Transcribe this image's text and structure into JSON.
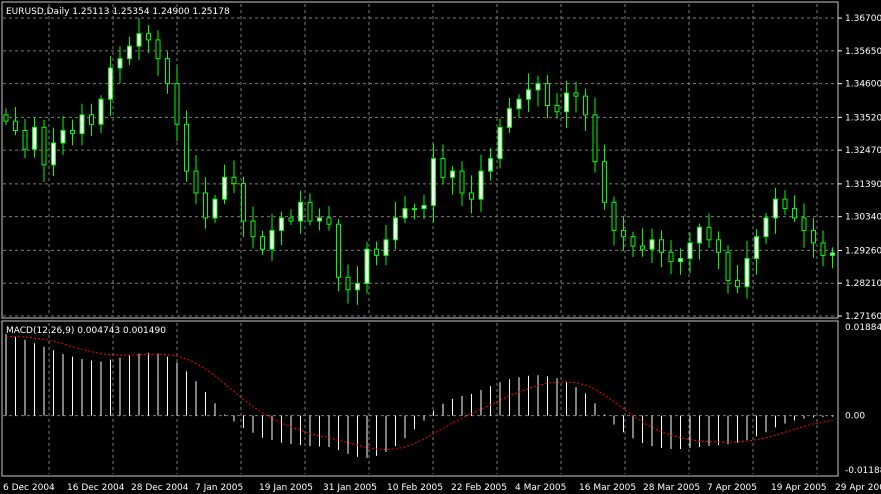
{
  "main_pane": {
    "title": "EURUSD,Daily  1.25113 1.25354 1.24900 1.25178",
    "price_ticks": [
      "1.36700",
      "1.35650",
      "1.34600",
      "1.33520",
      "1.32470",
      "1.31390",
      "1.30340",
      "1.29260",
      "1.28210",
      "1.27160"
    ]
  },
  "macd_pane": {
    "title": "MACD(12,26,9) 0.004743 0.001490",
    "ticks": [
      "0.018842",
      "0.00",
      "-0.011885"
    ]
  },
  "date_ticks": [
    "6 Dec 2004",
    "16 Dec 2004",
    "28 Dec 2004",
    "7 Jan 2005",
    "19 Jan 2005",
    "31 Jan 2005",
    "10 Feb 2005",
    "22 Feb 2005",
    "4 Mar 2005",
    "16 Mar 2005",
    "28 Mar 2005",
    "7 Apr 2005",
    "19 Apr 2005",
    "29 Apr 200"
  ],
  "colors": {
    "background": "#000000",
    "grid": "#7c7c7c",
    "candle_bull": "#ffffff",
    "candle_bear": "#000000",
    "wick": "#00ff00",
    "macd_histogram": "#ffffff",
    "signal_line": "#ff0000"
  },
  "chart_data": [
    {
      "type": "candlestick",
      "symbol": "EURUSD",
      "timeframe": "Daily",
      "ylim": [
        1.2716,
        1.3715
      ],
      "close": [
        1.334,
        1.331,
        1.325,
        1.332,
        1.32,
        1.327,
        1.331,
        1.33,
        1.336,
        1.333,
        1.341,
        1.351,
        1.354,
        1.358,
        1.362,
        1.36,
        1.354,
        1.346,
        1.333,
        1.318,
        1.311,
        1.303,
        1.309,
        1.316,
        1.314,
        1.302,
        1.297,
        1.293,
        1.299,
        1.303,
        1.302,
        1.308,
        1.302,
        1.303,
        1.301,
        1.284,
        1.28,
        1.282,
        1.293,
        1.291,
        1.296,
        1.303,
        1.306,
        1.306,
        1.307,
        1.322,
        1.316,
        1.318,
        1.311,
        1.309,
        1.318,
        1.322,
        1.332,
        1.338,
        1.341,
        1.344,
        1.346,
        1.339,
        1.337,
        1.343,
        1.342,
        1.336,
        1.321,
        1.308,
        1.299,
        1.297,
        1.294,
        1.293,
        1.296,
        1.292,
        1.289,
        1.29,
        1.295,
        1.3,
        1.296,
        1.292,
        1.283,
        1.281,
        1.29,
        1.297,
        1.303,
        1.309,
        1.306,
        1.303,
        1.299,
        1.295,
        1.291,
        1.2918
      ]
    },
    {
      "type": "bar",
      "indicator": "MACD(12,26,9)",
      "ylim": [
        -0.011885,
        0.018842
      ],
      "series": [
        {
          "values": [
            0.0166,
            0.016,
            0.0154,
            0.0147,
            0.014,
            0.0133,
            0.0125,
            0.012,
            0.0115,
            0.0112,
            0.011,
            0.0114,
            0.0118,
            0.0122,
            0.0126,
            0.0128,
            0.0126,
            0.012,
            0.0108,
            0.009,
            0.007,
            0.0048,
            0.0025,
            0.0002,
            -0.0012,
            -0.0025,
            -0.0035,
            -0.0045,
            -0.005,
            -0.0055,
            -0.0058,
            -0.006,
            -0.0062,
            -0.0063,
            -0.0064,
            -0.007,
            -0.0078,
            -0.0084,
            -0.0086,
            -0.0082,
            -0.0074,
            -0.0062,
            -0.0046,
            -0.0028,
            -0.001,
            0.001,
            0.0024,
            0.0034,
            0.004,
            0.0044,
            0.0052,
            0.006,
            0.0068,
            0.0074,
            0.0078,
            0.0081,
            0.0082,
            0.008,
            0.0076,
            0.0068,
            0.0058,
            0.0045,
            0.0025,
            0.0002,
            -0.0018,
            -0.0034,
            -0.0046,
            -0.0056,
            -0.0062,
            -0.0066,
            -0.0068,
            -0.0068,
            -0.0066,
            -0.0064,
            -0.0062,
            -0.006,
            -0.0058,
            -0.0055,
            -0.005,
            -0.0042,
            -0.0034,
            -0.0024,
            -0.0016,
            -0.001,
            -0.0006,
            -0.0004,
            -0.0003,
            -0.0002
          ]
        },
        {
          "values": [
            0.016,
            0.0161,
            0.016,
            0.0158,
            0.0155,
            0.0151,
            0.0146,
            0.014,
            0.0135,
            0.013,
            0.0126,
            0.0124,
            0.0123,
            0.0123,
            0.0124,
            0.0125,
            0.0125,
            0.0124,
            0.0121,
            0.0115,
            0.0106,
            0.0095,
            0.0081,
            0.0065,
            0.0049,
            0.0033,
            0.0018,
            0.0005,
            -0.0006,
            -0.0015,
            -0.0023,
            -0.003,
            -0.0036,
            -0.0041,
            -0.0045,
            -0.005,
            -0.0055,
            -0.006,
            -0.0065,
            -0.0068,
            -0.0069,
            -0.0068,
            -0.0064,
            -0.0057,
            -0.0048,
            -0.0037,
            -0.0026,
            -0.0015,
            -0.0005,
            0.0004,
            0.0013,
            0.0022,
            0.0031,
            0.004,
            0.0048,
            0.0055,
            0.0061,
            0.0066,
            0.0068,
            0.0069,
            0.0067,
            0.0062,
            0.0054,
            0.0042,
            0.0028,
            0.0014,
            0.0,
            -0.0013,
            -0.0024,
            -0.0033,
            -0.004,
            -0.0045,
            -0.0049,
            -0.0052,
            -0.0053,
            -0.0054,
            -0.0054,
            -0.0054,
            -0.0052,
            -0.0049,
            -0.0045,
            -0.004,
            -0.0034,
            -0.0028,
            -0.0022,
            -0.0017,
            -0.0013,
            -0.001
          ]
        }
      ]
    }
  ]
}
